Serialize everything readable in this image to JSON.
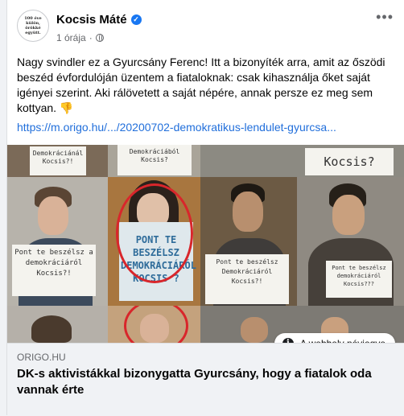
{
  "author": {
    "name": "Kocsis Máté",
    "avatar_text": "100 éve külön, örökké együtt.",
    "verified_icon": "verified-badge-icon"
  },
  "meta": {
    "time": "1 órája",
    "separator": "·",
    "privacy_icon": "globe-icon"
  },
  "menu": {
    "more_label": "•••"
  },
  "post": {
    "text": "Nagy svindler ez a Gyurcsány Ferenc! Itt a bizonyíték arra, amit az őszödi beszéd évfordulóján üzentem a fiataloknak: csak kihasználja őket saját igényei szerint. Aki rálövetett a saját népére, annak persze ez meg sem kottyan. 👎",
    "link": "https://m.origo.hu/.../20200702-demokratikus-lendulet-gyurcsa..."
  },
  "image": {
    "signs": [
      "Demokráciánál Kocsis?!",
      "Demokráciából Kocsis?",
      "Kocsis?",
      "Pont te beszélsz a demokráciáról Kocsis?!",
      "PONT TE BESZÉLSZ DEMOKRÁCIÁRÓL KOCSIS ?",
      "Pont te beszélsz Demokráciáról Kocsis?!",
      "Pont te beszélsz demokráciáról Kocsis???"
    ],
    "tooltip": "A webhely névjegye",
    "info_icon": "info-icon"
  },
  "preview": {
    "domain": "ORIGO.HU",
    "headline": "DK-s aktivistákkal bizonygatta Gyurcsány, hogy a fiatalok oda vannak érte"
  },
  "colors": {
    "link": "#216fdb",
    "verified": "#1877f2",
    "circle": "#d8262b"
  }
}
